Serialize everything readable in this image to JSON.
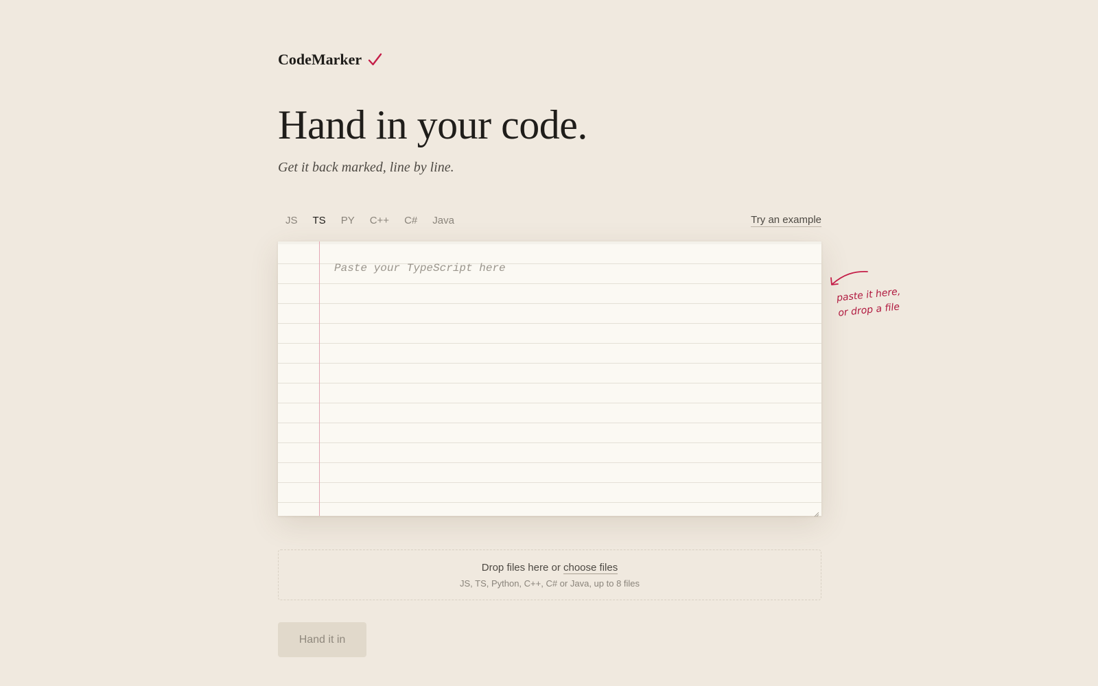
{
  "brand": {
    "name": "CodeMarker",
    "accent_color": "#c41e48"
  },
  "hero": {
    "title": "Hand in your code.",
    "subtitle": "Get it back marked, line by line."
  },
  "language_tabs": [
    {
      "label": "JS",
      "active": false
    },
    {
      "label": "TS",
      "active": true
    },
    {
      "label": "PY",
      "active": false
    },
    {
      "label": "C++",
      "active": false
    },
    {
      "label": "C#",
      "active": false
    },
    {
      "label": "Java",
      "active": false
    }
  ],
  "try_example_label": "Try an example",
  "editor": {
    "placeholder": "Paste your TypeScript here",
    "value": ""
  },
  "annotation": {
    "line1": "paste it here,",
    "line2": "or drop a file",
    "icon": "curved-arrow-icon"
  },
  "dropzone": {
    "prefix": "Drop files here or",
    "link": "choose files",
    "hint": "JS, TS, Python, C++, C# or Java, up to 8 files"
  },
  "submit": {
    "label": "Hand it in",
    "disabled": true
  }
}
